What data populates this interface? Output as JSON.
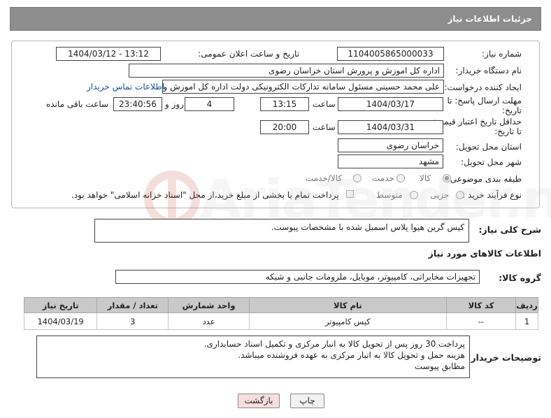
{
  "header": {
    "title": "جزئیات اطلاعات نیاز"
  },
  "form": {
    "need_number": {
      "label": "شماره نیاز:",
      "value": "1104005865000033"
    },
    "announce": {
      "label": "تاریخ و ساعت اعلان عمومی:",
      "value": "1404/03/12 - 13:12"
    },
    "buyer_org": {
      "label": "نام دستگاه خریدار:",
      "value": "اداره کل اموزش و پرورش استان خراسان رضوی"
    },
    "creator": {
      "label": "ایجاد کننده درخواست:",
      "value": "علی محمد حسینی مسئول سامانه تدارکات الکترونیکی دولت اداره کل اموزش و",
      "contact_link": "اطلاعات تماس خریدار"
    },
    "deadline": {
      "label_1": "مهلت ارسال پاسخ: تا",
      "label_2": "تاریخ:",
      "date": "1404/03/17",
      "time_label": "ساعت",
      "time": "13:15",
      "days": "4",
      "days_label": "روز و",
      "remaining": "23:40:56",
      "remaining_label": "ساعت باقی مانده"
    },
    "validity": {
      "label_1": "حداقل تاریخ اعتبار قیمت:",
      "label_2": "تا تاریخ:",
      "date": "1404/03/31",
      "time_label": "ساعت",
      "time": "20:00"
    },
    "delivery_province": {
      "label": "استان محل تحویل:",
      "value": "خراسان رضوی"
    },
    "delivery_city": {
      "label": "شهر محل تحویل:",
      "value": "مشهد"
    },
    "category": {
      "label": "طبقه بندی موضوعی:",
      "options": [
        "کالا",
        "خدمت",
        "کالا/خدمت"
      ],
      "selected": "کالا"
    },
    "process": {
      "label": "نوع فرآیند خرید :",
      "options": [
        "جزیی",
        "متوسط"
      ],
      "payment_note": "پرداخت تمام یا بخشی از مبلغ خرید،از محل \"اسناد خزانه اسلامی\" خواهد بود."
    }
  },
  "description": {
    "label": "شرح کلی نیاز:",
    "value": "کیس گرین هیوا پلاس اسمبل شده با مشخصات پیوست."
  },
  "goods_section": {
    "title": "اطلاعات کالاهای مورد نیاز",
    "group_label": "گروه کالا:",
    "group_value": "تجهیزات مخابراتی، کامپیوتر، موبایل، ملزومات جانبی و شبکه"
  },
  "table": {
    "headers": [
      "ردیف",
      "کد کالا",
      "نام کالا",
      "واحد شمارش",
      "تعداد / مقدار",
      "تاریخ نیاز"
    ],
    "rows": [
      [
        "1",
        "--",
        "کیس کامپیوتر",
        "عدد",
        "3",
        "1404/03/19"
      ]
    ]
  },
  "buyer_notes": {
    "label": "توضیحات خریدار:",
    "lines": [
      "پرداخت 30 روز پس از تحویل کالا به انبار مرکزی و تکمیل اسناد حسابداری.",
      "هزینه حمل و تحویل کالا به انبار مرکزی به عهده فروشنده میباشد.",
      "مطابق پیوست"
    ]
  },
  "watermark": {
    "text": "AriaTender.neT"
  },
  "buttons": {
    "print": "چاپ",
    "back": "بازگشت"
  },
  "colors": {
    "header_bg": "#8d8d8d",
    "table_header_bg": "#c9c9c9",
    "link": "#1a4fa0",
    "back_button_bg": "#f6dede"
  }
}
